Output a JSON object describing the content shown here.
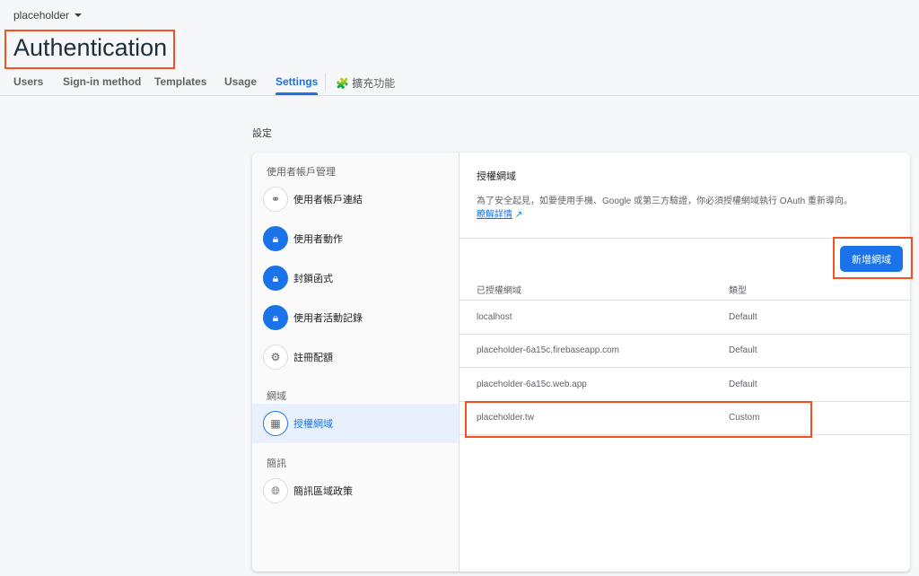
{
  "project": "placeholder",
  "title": "Authentication",
  "tabs": [
    "Users",
    "Sign-in method",
    "Templates",
    "Usage",
    "Settings",
    "擴充功能"
  ],
  "section_label": "設定",
  "nav": {
    "group1": "使用者帳戶管理",
    "items1": [
      "使用者帳戶連結",
      "使用者動作",
      "封鎖函式",
      "使用者活動記錄",
      "註冊配額"
    ],
    "group2": "網域",
    "item2": "授權網域",
    "group3": "簡訊",
    "item3": "簡訊區域政策"
  },
  "main": {
    "heading": "授權網域",
    "description": "為了安全起見，如要使用手機、Google 或第三方驗證，你必須授權網域執行 OAuth 重新導向。",
    "learn_more": "瞭解詳情",
    "add_button": "新增網域",
    "columns": [
      "已授權網域",
      "類型"
    ],
    "rows": [
      {
        "domain": "localhost",
        "type": "Default"
      },
      {
        "domain": "placeholder-6a15c.firebaseapp.com",
        "type": "Default"
      },
      {
        "domain": "placeholder-6a15c.web.app",
        "type": "Default"
      },
      {
        "domain": "placeholder.tw",
        "type": "Custom"
      }
    ]
  },
  "colors": {
    "accent": "#1a73e8",
    "highlight": "#f4511e"
  }
}
